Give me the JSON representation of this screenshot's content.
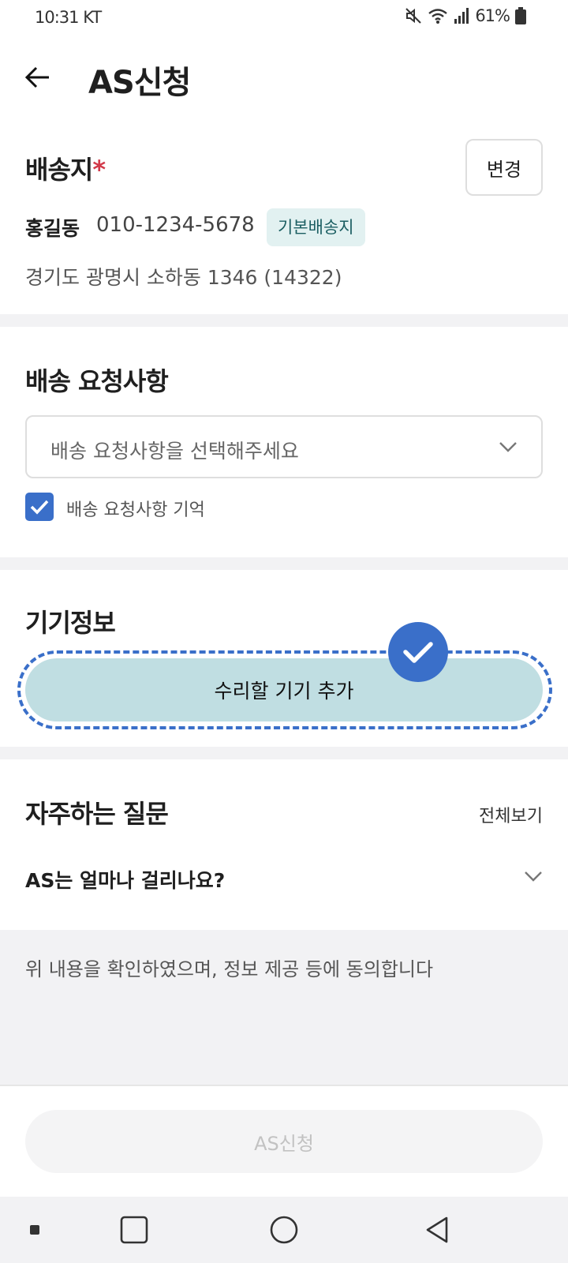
{
  "status_bar": {
    "time": "10:31 KT",
    "battery": "61%",
    "icons": [
      "mute-icon",
      "wifi-icon",
      "signal-icon",
      "battery-icon"
    ]
  },
  "app_bar": {
    "title": "AS신청",
    "back_icon": "arrow-left-icon"
  },
  "shipping": {
    "title": "배송지",
    "required_mark": "*",
    "change_label": "변경",
    "name": "홍길동",
    "phone": "010-1234-5678",
    "badge": "기본배송지",
    "address": "경기도 광명시 소하동 1346 (14322)"
  },
  "delivery_request": {
    "title": "배송 요청사항",
    "placeholder": "배송 요청사항을 선택해주세요",
    "remember_label": "배송 요청사항 기억",
    "remember_checked": true
  },
  "device": {
    "title": "기기정보",
    "add_label": "수리할 기기 추가"
  },
  "faq": {
    "title": "자주하는 질문",
    "view_all": "전체보기",
    "items": [
      {
        "question": "AS는 얼마나 걸리나요?"
      }
    ]
  },
  "consent": {
    "text": "위 내용을 확인하였으며, 정보 제공 등에 동의합니다"
  },
  "submit": {
    "label": "AS신청",
    "enabled": false
  },
  "nav_bar": {
    "items": [
      "recent-apps-dot-icon",
      "square-icon",
      "circle-home-icon",
      "triangle-back-icon"
    ]
  },
  "colors": {
    "accent": "#3a6fc9",
    "required": "#d23a4a",
    "badge_bg": "#e2f1f1",
    "add_button_bg": "#c0dee2"
  }
}
